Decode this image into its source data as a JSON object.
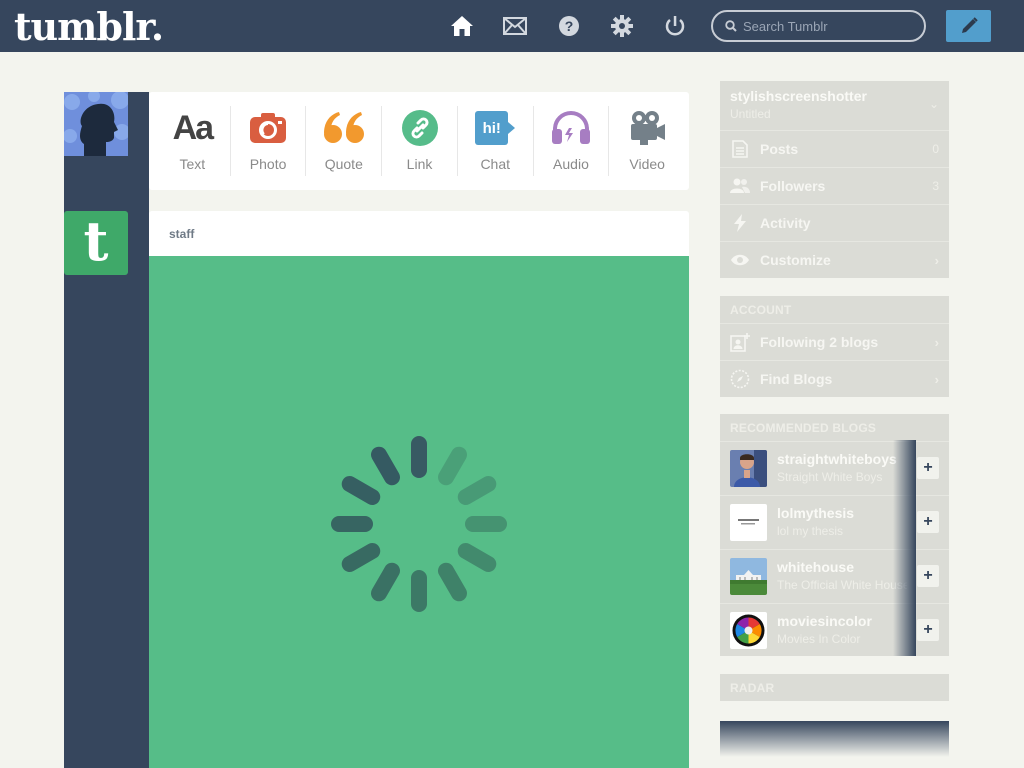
{
  "header": {
    "logo": "tumblr.",
    "search_placeholder": "Search Tumblr",
    "nav_icons": [
      "home-icon",
      "mail-icon",
      "help-icon",
      "settings-icon",
      "power-icon"
    ],
    "compose_icon": "pencil-icon"
  },
  "post_types": [
    {
      "label": "Text",
      "icon": "Aa",
      "color": "#444444"
    },
    {
      "label": "Photo",
      "color": "#d95e40"
    },
    {
      "label": "Quote",
      "color": "#f2992e"
    },
    {
      "label": "Link",
      "color": "#56bc8a"
    },
    {
      "label": "Chat",
      "icon": "hi!",
      "color": "#529ecc"
    },
    {
      "label": "Audio",
      "color": "#a77dc2"
    },
    {
      "label": "Video",
      "color": "#748089"
    }
  ],
  "post": {
    "author": "staff",
    "body_color": "#56bd88"
  },
  "sidebar": {
    "blog": {
      "name": "stylishscreenshotter",
      "subtitle": "Untitled"
    },
    "blog_items": [
      {
        "label": "Posts",
        "count": "0",
        "icon": "posts-icon"
      },
      {
        "label": "Followers",
        "count": "3",
        "icon": "followers-icon"
      },
      {
        "label": "Activity",
        "icon": "activity-icon"
      },
      {
        "label": "Customize",
        "arrow": "›",
        "icon": "eye-icon"
      }
    ],
    "account_header": "ACCOUNT",
    "account_items": [
      {
        "label": "Following 2 blogs",
        "arrow": "›",
        "icon": "following-icon"
      },
      {
        "label": "Find Blogs",
        "arrow": "›",
        "icon": "compass-icon"
      }
    ],
    "recommended_header": "RECOMMENDED BLOGS",
    "recommended": [
      {
        "name": "straightwhiteboys",
        "subtitle": "Straight White Boys"
      },
      {
        "name": "lolmythesis",
        "subtitle": "lol my thesis"
      },
      {
        "name": "whitehouse",
        "subtitle": "The Official White House"
      },
      {
        "name": "moviesincolor",
        "subtitle": "Movies In Color"
      }
    ],
    "follow_label": "+",
    "radar_header": "RADAR"
  }
}
